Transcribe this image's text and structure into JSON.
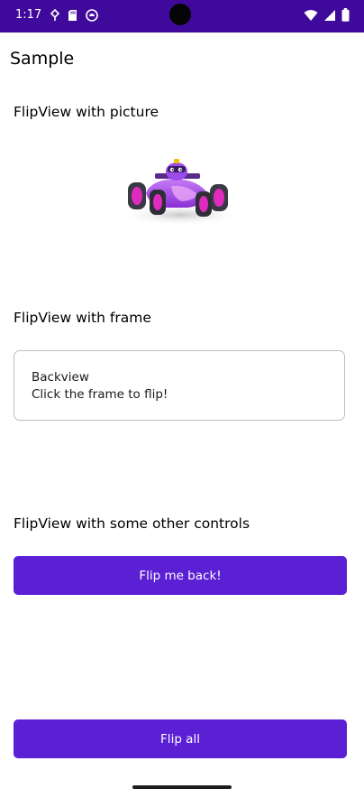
{
  "status_bar": {
    "time": "1:17",
    "background": "#3f0a9c",
    "left_icons": [
      "data-saver-icon",
      "sd-card-icon",
      "android-system-icon"
    ],
    "right_icons": [
      "wifi-icon",
      "cellular-signal-icon",
      "battery-icon"
    ]
  },
  "app": {
    "title": "Sample"
  },
  "sections": {
    "picture": {
      "title": "FlipView with picture"
    },
    "frame": {
      "title": "FlipView with frame",
      "line1": "Backview",
      "line2": "Click the frame to flip!"
    },
    "controls": {
      "title": "FlipView with some other controls",
      "button_label": "Flip me back!"
    }
  },
  "footer": {
    "flip_all_label": "Flip all"
  },
  "colors": {
    "accent": "#5b1fd4",
    "car_body": "#a94be6",
    "car_wheel_rim": "#e02bbf"
  }
}
